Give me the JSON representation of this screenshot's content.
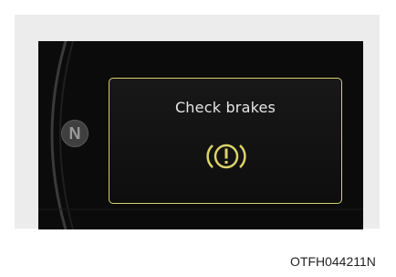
{
  "display": {
    "gear": "N",
    "message": "Check brakes",
    "warning_icon": "brake-warning-icon",
    "accent_color": "#dcd36b"
  },
  "caption": "OTFH044211N"
}
